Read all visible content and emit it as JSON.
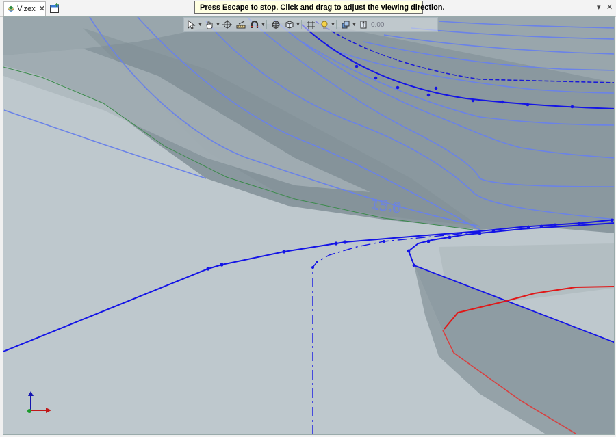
{
  "tab": {
    "label": "Vizex",
    "close": "✕"
  },
  "hint": "Press Escape to stop. Click and drag to adjust the viewing direction.",
  "window": {
    "menu_glyph": "▾",
    "close_glyph": "✕"
  },
  "toolbar": {
    "value": "0.00"
  },
  "scene": {
    "contour_label": "15.0"
  },
  "colors": {
    "accent": "#1414e6",
    "terrain": "#bec8cd",
    "slope": "#8e9ca3",
    "boundary": "#e01818"
  }
}
